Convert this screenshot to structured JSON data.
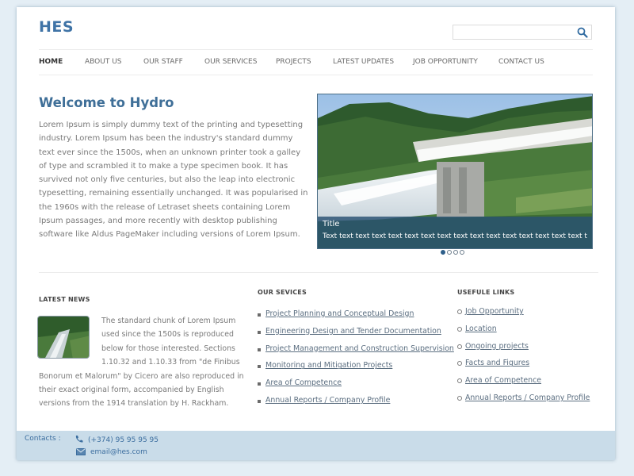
{
  "header": {
    "logo": "HES",
    "search_placeholder": ""
  },
  "nav": {
    "items": [
      {
        "label": "HOME"
      },
      {
        "label": "ABOUT US"
      },
      {
        "label": "OUR STAFF"
      },
      {
        "label": "OUR SERVICES"
      },
      {
        "label": "PROJECTS"
      },
      {
        "label": "LATEST UPDATES"
      },
      {
        "label": "JOB OPPORTUNITY"
      },
      {
        "label": "CONTACT US"
      }
    ]
  },
  "welcome": {
    "title": "Welcome to Hydro",
    "text": "Lorem Ipsum is simply dummy text of the printing and typesetting industry. Lorem Ipsum has been the industry's standard dummy text ever since the 1500s, when an unknown printer took a galley of type and scrambled it to make a type specimen book. It has survived not only five centuries, but also the leap into electronic typesetting, remaining essentially unchanged. It was popularised in the 1960s with the release of Letraset sheets containing Lorem Ipsum passages, and more recently with desktop publishing software like Aldus PageMaker including versions of Lorem Ipsum."
  },
  "slider": {
    "caption_title": "Title",
    "caption_text": "Text text text text text text text text text text text text text text text text text a",
    "dots": [
      true,
      false,
      false,
      false
    ]
  },
  "news": {
    "heading": "LATEST NEWS",
    "text": "The standard chunk of Lorem Ipsum used since the 1500s is reproduced below for those interested. Sections 1.10.32 and 1.10.33 from \"de Finibus Bonorum et Malorum\" by Cicero are also reproduced in their exact original form, accompanied by English versions from the 1914 translation by H. Rackham."
  },
  "services": {
    "heading": "OUR SEVICES",
    "items": [
      {
        "label": "Project Planning and Conceptual Design"
      },
      {
        "label": "Engineering Design and Tender Documentation"
      },
      {
        "label": "Project Management and Construction Supervision"
      },
      {
        "label": "Monitoring and Mitigation Projects"
      },
      {
        "label": "Area of Competence"
      },
      {
        "label": "Annual Reports / Company Profile"
      }
    ]
  },
  "links": {
    "heading": "USEFULE LINKS",
    "items": [
      {
        "label": "Job Opportunity"
      },
      {
        "label": "Location"
      },
      {
        "label": "Ongoing projects"
      },
      {
        "label": "Facts and Figures"
      },
      {
        "label": "Area of Competence"
      },
      {
        "label": "Annual Reports / Company Profile"
      }
    ]
  },
  "footer": {
    "contacts_label": "Contacts :",
    "phone": "(+374) 95 95 95 95",
    "email": "email@hes.com"
  },
  "colors": {
    "brand": "#3f73a6",
    "footer_bg": "#c9dce9",
    "caption_bg": "#285073"
  },
  "icons": {
    "search": "search-icon",
    "phone": "phone-icon",
    "email": "envelope-icon"
  }
}
